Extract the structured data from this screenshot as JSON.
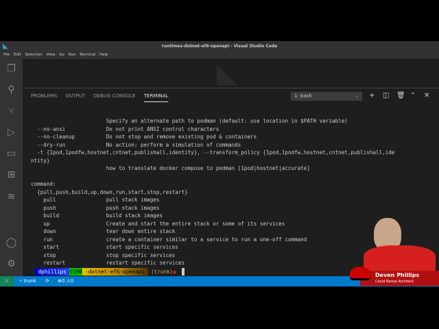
{
  "window": {
    "title": "runtimes-dotnet-ef6-openapi - Visual Studio Code"
  },
  "menu": [
    "File",
    "Edit",
    "Selection",
    "View",
    "Go",
    "Run",
    "Terminal",
    "Help"
  ],
  "panel": {
    "tabs": [
      "PROBLEMS",
      "OUTPUT",
      "DEBUG CONSOLE",
      "TERMINAL"
    ],
    "active_tab": "TERMINAL",
    "terminal_select": "1: bash"
  },
  "terminal": {
    "lines": [
      "                        Specify an alternate path to podman (default: use location in $PATH variable)",
      "  --no-ansi             Do not print ANSI control characters",
      "  --no-cleanup          Do not stop and remove existing pod & containers",
      "  --dry-run             No action; perform a simulation of commands",
      "  -t {1pod,1podfw,hostnet,cntnet,publishall,identity}, --transform_policy {1pod,1podfw,hostnet,cntnet,publishall,ide",
      "ntity}",
      "                        how to translate docker compose to podman [1pod|hostnet|accurate]",
      "",
      "command:",
      "  {pull,push,build,up,down,run,start,stop,restart}",
      "    pull                pull stack images",
      "    push                push stack images",
      "    build               build stack images",
      "    up                  Create and start the entire stack or some of its services",
      "    down                tear down entire stack",
      "    run                 create a container similar to a service to run a one-off command",
      "    start               start specific services",
      "    stop                stop specific services",
      "    restart             restart specific services"
    ]
  },
  "prompt": {
    "user": " dphillips ",
    "host": "t590",
    "dir": " -dotnet-ef6-openapi ",
    "branch": " (trunk)",
    "dirty": "●"
  },
  "status": {
    "branch": "trunk",
    "errors": "0",
    "warnings": "0"
  },
  "overlay": {
    "name": "Deven Phillips",
    "title": "Cloud Native Architect"
  }
}
